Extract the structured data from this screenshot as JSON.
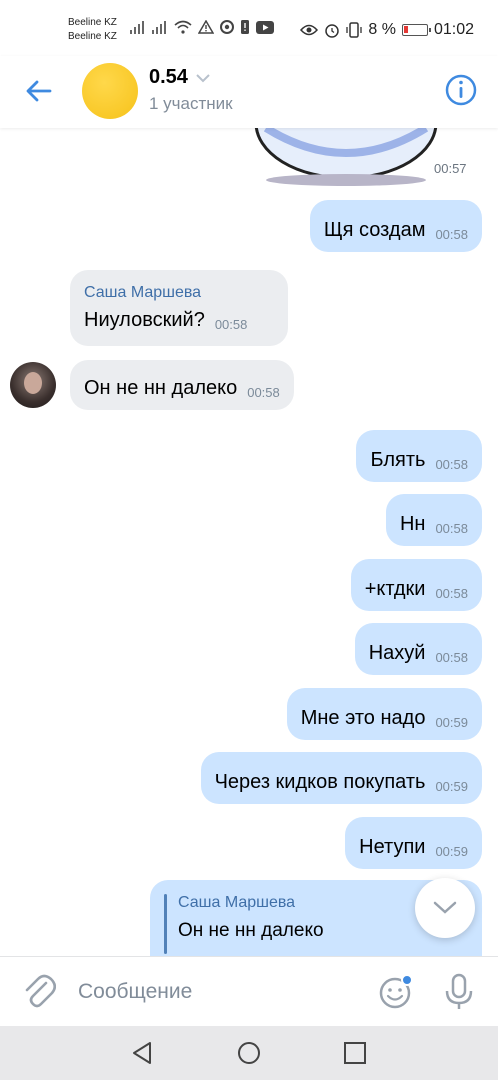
{
  "status_bar": {
    "carrier_1": "Beeline KZ",
    "carrier_2": "Beeline KZ",
    "battery": "8 %",
    "time": "01:02"
  },
  "header": {
    "title": "0.54",
    "subtitle": "1 участник"
  },
  "sticker": {
    "time": "00:57"
  },
  "messages": [
    {
      "text": "Щя создам",
      "time": "00:58"
    },
    {
      "sender": "Саша Маршева",
      "text": "Ниуловский?",
      "time": "00:58"
    },
    {
      "text": "Он не нн далеко",
      "time": "00:58"
    },
    {
      "text": "Блять",
      "time": "00:58"
    },
    {
      "text": "Нн",
      "time": "00:58"
    },
    {
      "text": "+ктдки",
      "time": "00:58"
    },
    {
      "text": "Нахуй",
      "time": "00:58"
    },
    {
      "text": "Мне это надо",
      "time": "00:59"
    },
    {
      "text": "Через кидков покупать",
      "time": "00:59"
    },
    {
      "text": "Нетупи",
      "time": "00:59"
    }
  ],
  "reply": {
    "sender": "Саша Маршева",
    "text": "Он не нн далеко"
  },
  "composer": {
    "placeholder": "Сообщение"
  },
  "colors": {
    "accent": "#3f8ae0",
    "outgoing_bubble": "#cce4ff",
    "incoming_bubble": "#ebedf0",
    "sender_name": "#3f6fa8"
  },
  "icons": [
    "back-arrow-icon",
    "info-icon",
    "chevron-down-icon",
    "paperclip-icon",
    "emoji-icon",
    "microphone-icon",
    "nav-back-icon",
    "nav-home-icon",
    "nav-recents-icon"
  ]
}
